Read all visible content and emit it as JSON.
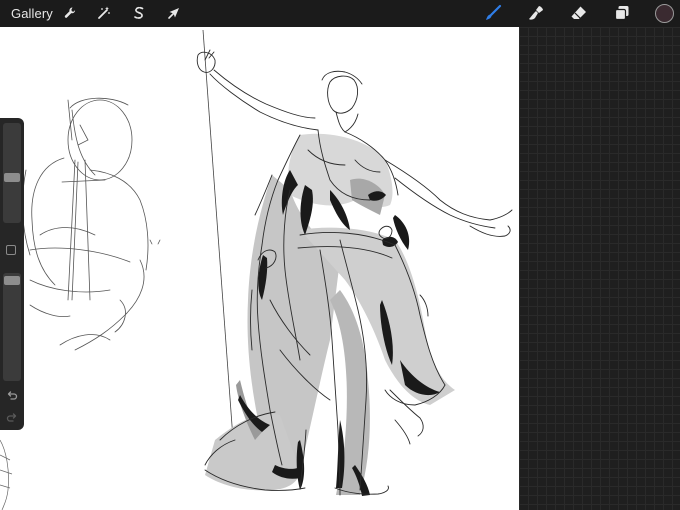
{
  "topbar": {
    "gallery_label": "Gallery",
    "actions_icon": "wrench-icon",
    "adjustments_icon": "magic-wand-icon",
    "selection_icon": "selection-s-icon",
    "transform_icon": "arrow-cursor-icon",
    "brush_icon": "brush-icon",
    "smudge_icon": "smudge-icon",
    "eraser_icon": "eraser-icon",
    "layers_icon": "layers-icon",
    "active_tool": "brush",
    "accent_color": "#2f7ee8",
    "current_color": "#3a2a30"
  },
  "sidebar": {
    "brush_size_level": 0.45,
    "opacity_level": 0.97,
    "undo_icon": "undo-icon",
    "redo_icon": "redo-icon"
  }
}
